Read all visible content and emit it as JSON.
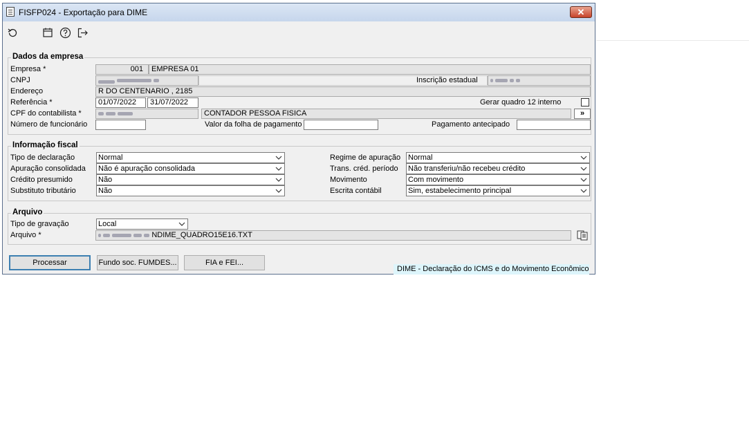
{
  "window": {
    "title": "FISFP024 - Exportação para DIME",
    "close_symbol": "✕"
  },
  "toolbar": {
    "icons": [
      "refresh-icon",
      "calendar-icon",
      "help-icon",
      "exit-icon"
    ]
  },
  "empresa": {
    "group_title": "Dados da empresa",
    "empresa_label": "Empresa *",
    "empresa_code": "001",
    "empresa_name": "EMPRESA 01",
    "cnpj_label": "CNPJ",
    "inscricao_label": "Inscrição estadual",
    "endereco_label": "Endereço",
    "endereco_value": "R DO CENTENARIO , 2185",
    "referencia_label": "Referência *",
    "ref_start": "01/07/2022",
    "ref_end": "31/07/2022",
    "gerar_label": "Gerar quadro 12 interno",
    "cpf_label": "CPF do contabilista *",
    "contador_name": "CONTADOR PESSOA FISICA",
    "more_button": "»",
    "num_func_label": "Número de funcionário",
    "folha_label": "Valor da folha de pagamento",
    "pagamento_label": "Pagamento antecipado"
  },
  "fiscal": {
    "group_title": "Informação fiscal",
    "tipo_decl_label": "Tipo de declaração",
    "tipo_decl_value": "Normal",
    "apuracao_label": "Apuração consolidada",
    "apuracao_value": "Não é apuração consolidada",
    "credito_label": "Crédito presumido",
    "credito_value": "Não",
    "substituto_label": "Substituto tributário",
    "substituto_value": "Não",
    "regime_label": "Regime de apuração",
    "regime_value": "Normal",
    "trans_label": "Trans. créd. período",
    "trans_value": "Não transferiu/não recebeu crédito",
    "movimento_label": "Movimento",
    "movimento_value": "Com movimento",
    "escrita_label": "Escrita contábil",
    "escrita_value": "Sim, estabelecimento principal"
  },
  "arquivo": {
    "group_title": "Arquivo",
    "tipo_grav_label": "Tipo de gravação",
    "tipo_grav_value": "Local",
    "arquivo_label": "Arquivo *",
    "arquivo_value": "NDIME_QUADRO15E16.TXT"
  },
  "buttons": {
    "processar": "Processar",
    "fundo": "Fundo soc. FUMDES...",
    "fia": "FIA e FEI..."
  },
  "status": {
    "text": "DIME - Declaração do ICMS e do Movimento Econômico"
  }
}
